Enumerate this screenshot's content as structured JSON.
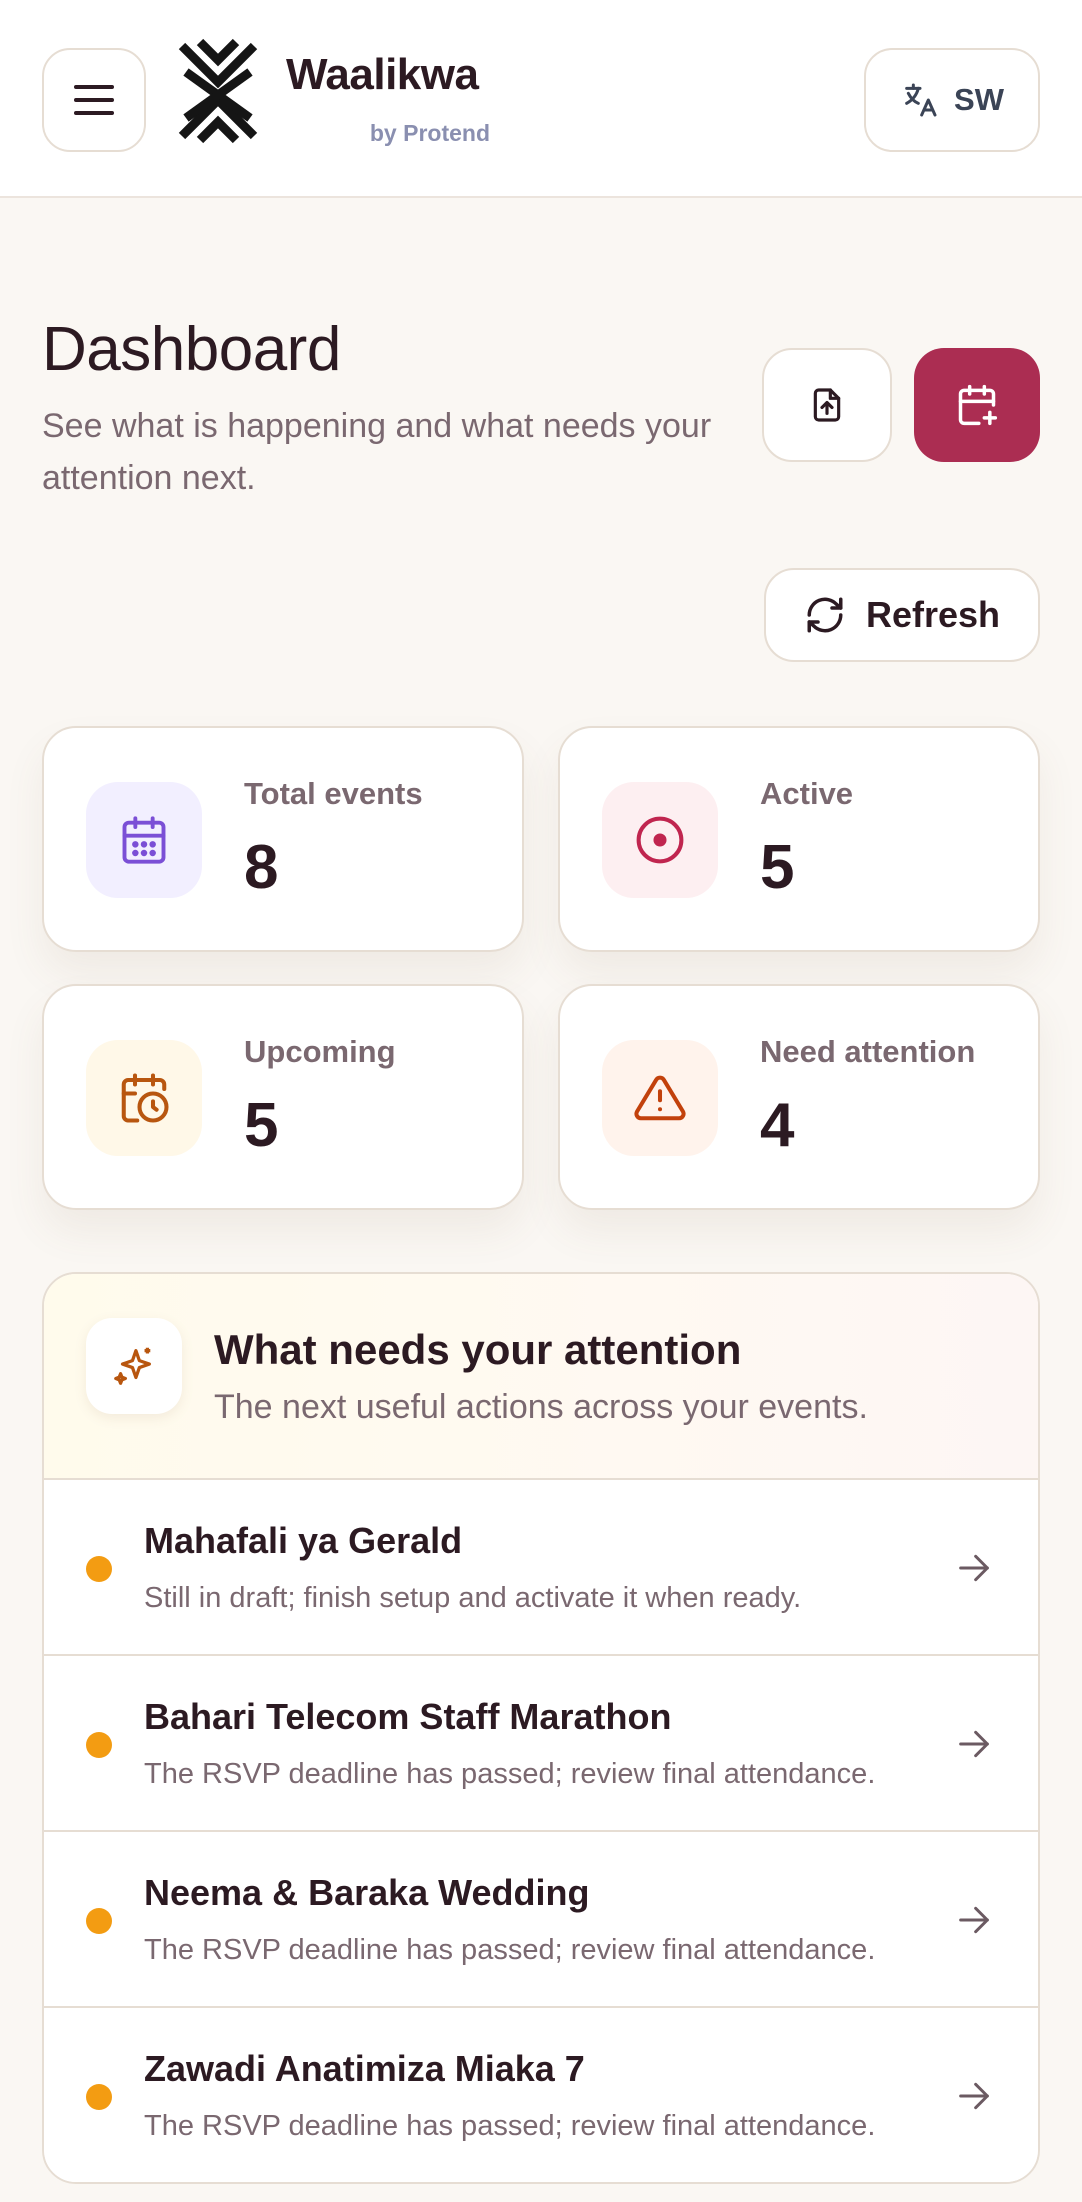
{
  "header": {
    "brand_name": "Waalikwa",
    "brand_sub": "by Protend",
    "language": "SW"
  },
  "page": {
    "title": "Dashboard",
    "subtitle": "See what is happening and what needs your attention next.",
    "refresh_label": "Refresh"
  },
  "stats": [
    {
      "label": "Total events",
      "value": "8",
      "icon": "calendar-icon",
      "color": "#7b4fd6",
      "bg": "#f2efff"
    },
    {
      "label": "Active",
      "value": "5",
      "icon": "target-icon",
      "color": "#c0254f",
      "bg": "#fdeff1"
    },
    {
      "label": "Upcoming",
      "value": "5",
      "icon": "calendar-clock-icon",
      "color": "#b8560f",
      "bg": "#fff8e8"
    },
    {
      "label": "Need attention",
      "value": "4",
      "icon": "warning-icon",
      "color": "#c2410c",
      "bg": "#fff3ec"
    }
  ],
  "attention": {
    "title": "What needs your attention",
    "subtitle": "The next useful actions across your events.",
    "items": [
      {
        "title": "Mahafali ya Gerald",
        "desc": "Still in draft; finish setup and activate it when ready."
      },
      {
        "title": "Bahari Telecom Staff Marathon",
        "desc": "The RSVP deadline has passed; review final attendance."
      },
      {
        "title": "Neema & Baraka Wedding",
        "desc": "The RSVP deadline has passed; review final attendance."
      },
      {
        "title": "Zawadi Anatimiza Miaka 7",
        "desc": "The RSVP deadline has passed; review final attendance."
      }
    ]
  },
  "colors": {
    "accent": "#ab2d52",
    "background": "#faf7f3",
    "status_dot": "#f39c12"
  }
}
